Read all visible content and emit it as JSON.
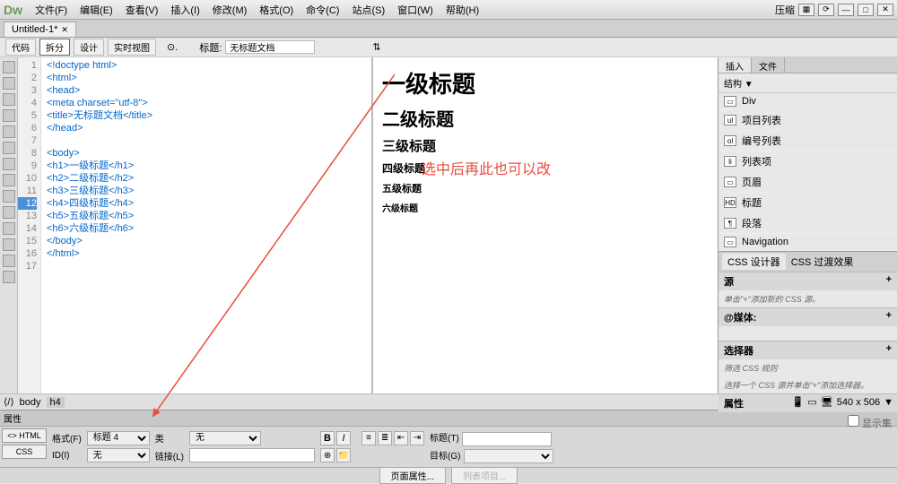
{
  "menu": [
    "文件(F)",
    "编辑(E)",
    "查看(V)",
    "插入(I)",
    "修改(M)",
    "格式(O)",
    "命令(C)",
    "站点(S)",
    "窗口(W)",
    "帮助(H)"
  ],
  "title_compress": "压缩",
  "doc_tab": "Untitled-1*",
  "view_buttons": {
    "code": "代码",
    "split": "拆分",
    "design": "设计",
    "live": "实时视图"
  },
  "title_label": "标题:",
  "title_value": "无标题文档",
  "code_lines": [
    "<!doctype html>",
    "<html>",
    "<head>",
    "<meta charset=\"utf-8\">",
    "<title>无标题文档</title>",
    "</head>",
    "",
    "<body>",
    "<h1>一级标题</h1>",
    "<h2>二级标题</h2>",
    "<h3>三级标题</h3>",
    "<h4>四级标题</h4>",
    "<h5>五级标题</h5>",
    "<h6>六级标题</h6>",
    "</body>",
    "</html>",
    ""
  ],
  "selected_line": 12,
  "preview": {
    "h1": "一级标题",
    "h2": "二级标题",
    "h3": "三级标题",
    "h4": "四级标题",
    "h5": "五级标题",
    "h6": "六级标题"
  },
  "annotation": "选中后再此也可以改",
  "right": {
    "tabs": [
      "插入",
      "文件"
    ],
    "dropdown": "结构 ▼",
    "items": [
      {
        "icon": "▭",
        "label": "Div"
      },
      {
        "icon": "ul",
        "label": "项目列表"
      },
      {
        "icon": "ol",
        "label": "编号列表"
      },
      {
        "icon": "li",
        "label": "列表项"
      },
      {
        "icon": "▭",
        "label": "页眉"
      },
      {
        "icon": "HD",
        "label": "标题"
      },
      {
        "icon": "¶",
        "label": "段落"
      },
      {
        "icon": "▭",
        "label": "Navigation"
      }
    ],
    "css_tabs": [
      "CSS 设计器",
      "CSS 过渡效果"
    ],
    "sections": {
      "source": {
        "title": "源",
        "hint": "单击\"+\"添加新的 CSS 源。",
        "plus": "+"
      },
      "media": {
        "title": "@媒体:",
        "plus": "+"
      },
      "selector": {
        "title": "选择器",
        "hint": "筛选 CSS 规则",
        "hint2": "选择一个 CSS 源并单击\"+\"添加选择器。",
        "plus": "+"
      },
      "props": {
        "title": "属性",
        "show": "显示集"
      }
    }
  },
  "status": {
    "path": [
      "body",
      "h4"
    ],
    "size": "540 x 506"
  },
  "props": {
    "title": "属性",
    "mode_html": "<> HTML",
    "mode_css": "CSS",
    "format_label": "格式(F)",
    "format_value": "标题 4",
    "class_label": "类",
    "class_value": "无",
    "id_label": "ID(I)",
    "id_value": "无",
    "link_label": "链接(L)",
    "title2_label": "标题(T)",
    "target_label": "目标(G)",
    "page_props": "页面属性...",
    "list_item": "列表项目..."
  }
}
